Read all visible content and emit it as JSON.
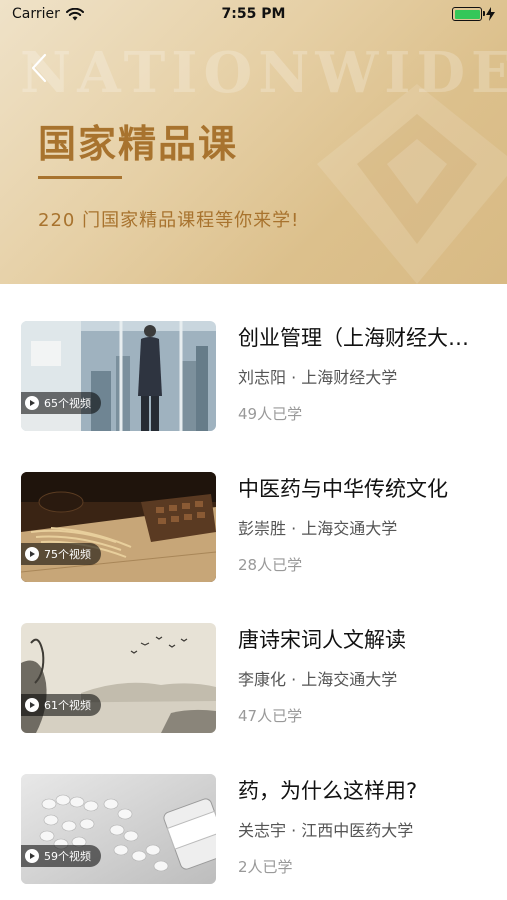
{
  "status_bar": {
    "carrier": "Carrier",
    "time": "7:55 PM"
  },
  "header": {
    "watermark": "NATIONWIDE",
    "title": "国家精品课",
    "subtitle": "220 门国家精品课程等你来学!",
    "accent_color": "#a8732e"
  },
  "courses": [
    {
      "title": "创业管理（上海财经大学）",
      "teacher_school": "刘志阳 · 上海财经大学",
      "learners": "49人已学",
      "video_count": "65个视频",
      "thumb": "business-man-window"
    },
    {
      "title": "中医药与中华传统文化",
      "teacher_school": "彭崇胜 · 上海交通大学",
      "learners": "28人已学",
      "video_count": "75个视频",
      "thumb": "chinese-herbs"
    },
    {
      "title": "唐诗宋词人文解读",
      "teacher_school": "李康化 · 上海交通大学",
      "learners": "47人已学",
      "video_count": "61个视频",
      "thumb": "ink-landscape"
    },
    {
      "title": "药，为什么这样用?",
      "teacher_school": "关志宇 · 江西中医药大学",
      "learners": "2人已学",
      "video_count": "59个视频",
      "thumb": "pills-bottle"
    }
  ]
}
